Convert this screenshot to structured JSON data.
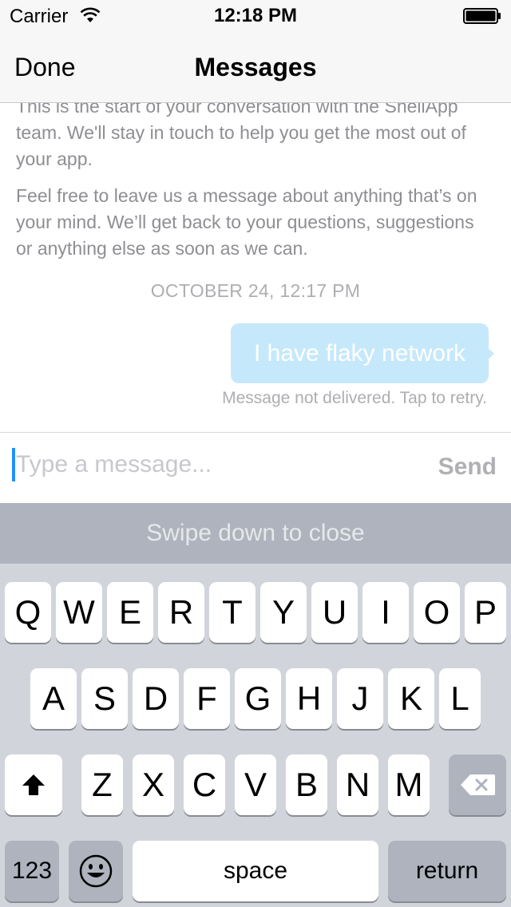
{
  "status_bar": {
    "carrier": "Carrier",
    "time": "12:18 PM",
    "wifi_icon": "wifi-icon",
    "battery_icon": "battery-icon"
  },
  "nav": {
    "done_label": "Done",
    "title": "Messages"
  },
  "conversation": {
    "intro_paragraph_1": "This is the start of your conversation with the ShellApp team. We'll stay in touch to help you get the most out of your app.",
    "intro_paragraph_2": "Feel free to leave us a message about anything that’s on your mind. We’ll get back to your questions, suggestions or anything else as soon as we can.",
    "timestamp": "OCTOBER 24, 12:17 PM",
    "messages": [
      {
        "text": "I have flaky network",
        "status": "Message not delivered. Tap to retry."
      }
    ]
  },
  "input": {
    "placeholder": "Type a message...",
    "value": "",
    "send_label": "Send"
  },
  "swipe_hint": "Swipe down to close",
  "keyboard": {
    "row1": [
      "Q",
      "W",
      "E",
      "R",
      "T",
      "Y",
      "U",
      "I",
      "O",
      "P"
    ],
    "row2": [
      "A",
      "S",
      "D",
      "F",
      "G",
      "H",
      "J",
      "K",
      "L"
    ],
    "row3": [
      "Z",
      "X",
      "C",
      "V",
      "B",
      "N",
      "M"
    ],
    "numbers_label": "123",
    "space_label": "space",
    "return_label": "return",
    "shift_icon": "shift-icon",
    "delete_icon": "delete-icon",
    "emoji_icon": "emoji-icon"
  },
  "colors": {
    "bubble": "#c6e8fb",
    "caret": "#1e90ff",
    "keyboard_bg": "#d1d5db",
    "swipe_bar_bg": "#afb3bd"
  }
}
